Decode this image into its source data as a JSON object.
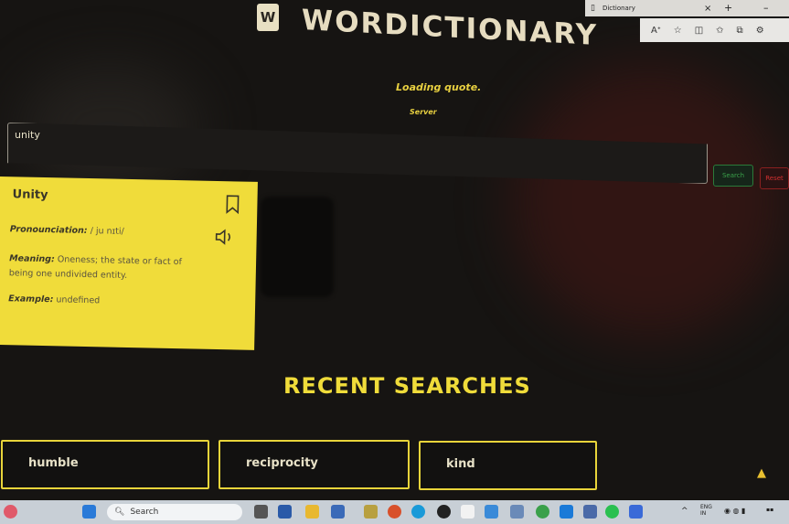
{
  "browser": {
    "tab_title": "Dictionary",
    "tab_close": "×",
    "new_tab": "+",
    "minimize": "–"
  },
  "app": {
    "logo_letter": "W",
    "title": "WORDICTIONARY"
  },
  "quote": {
    "loading_text": "Loading quote.",
    "source_text": "Server"
  },
  "search": {
    "value": "unity",
    "search_label": "Search",
    "reset_label": "Reset"
  },
  "definition": {
    "word": "Unity",
    "pronunciation_label": "Pronounciation:",
    "pronunciation_value": "/ ju nɪti/",
    "meaning_label": "Meaning:",
    "meaning_value": "Oneness; the state or fact of being one undivided entity.",
    "example_label": "Example:",
    "example_value": "undefined"
  },
  "recent": {
    "heading": "RECENT SEARCHES",
    "items": [
      "humble",
      "reciprocity",
      "kind"
    ]
  },
  "taskbar": {
    "search_label": "Search",
    "lang_top": "ENG",
    "lang_bottom": "IN"
  },
  "colors": {
    "accent_yellow": "#f0dc3a",
    "search_green": "#3aa04a",
    "reset_red": "#d03030",
    "background": "#161412"
  }
}
